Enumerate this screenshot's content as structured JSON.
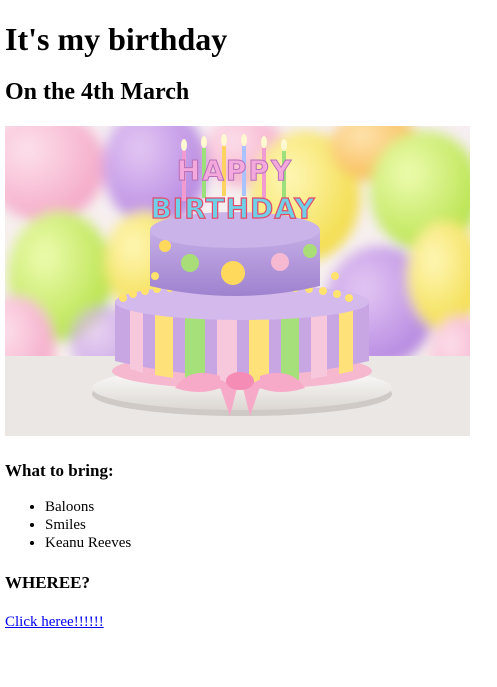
{
  "title": "It's my birthday",
  "subtitle": "On the 4th March",
  "image": {
    "cake_topper_line1": "HAPPY",
    "cake_topper_line2": "BIRTHDAY"
  },
  "bring": {
    "heading": "What to bring:",
    "items": [
      "Baloons",
      "Smiles",
      "Keanu Reeves"
    ]
  },
  "where": {
    "heading": "WHEREE?",
    "link_text": "Click heree!!!!!!"
  },
  "colors": {
    "link": "#0000EE",
    "text": "#000000",
    "background": "#ffffff"
  }
}
